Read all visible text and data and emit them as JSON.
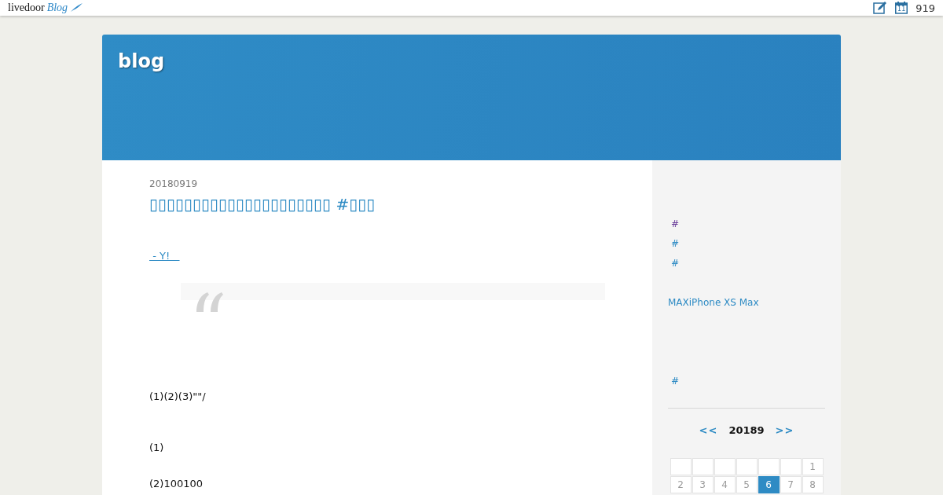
{
  "topbar": {
    "logo": {
      "brand": "livedoor",
      "product": "Blog"
    },
    "calendar_day": "11",
    "count": "919"
  },
  "header": {
    "title": "blog"
  },
  "article": {
    "date": "20180919",
    "title": "▯▯▯▯▯▯▯▯▯▯▯▯▯▯▯▯▯▯▯▯▯ #▯▯▯",
    "source_link": " - Y!   ",
    "quote": {
      "kind": "empty"
    },
    "paragraphs": [
      "(1)(2)(3)\"\"/",
      "(1)",
      "(2)100100"
    ]
  },
  "sidebar": {
    "sections": [
      {
        "links": [
          {
            "text": "#",
            "visited": true
          },
          {
            "text": "#",
            "visited": false
          },
          {
            "text": "#",
            "visited": false
          }
        ]
      },
      {
        "links": [
          {
            "text": "MAXiPhone XS Max",
            "visited": false
          }
        ]
      },
      {
        "links": [
          {
            "text": "#",
            "visited": false
          }
        ]
      }
    ],
    "calendar": {
      "prev": "<<",
      "month": "20189",
      "next": ">>",
      "weeks": [
        [
          {
            "kind": "empty"
          },
          {
            "kind": "empty"
          },
          {
            "kind": "empty"
          },
          {
            "kind": "empty"
          },
          {
            "kind": "empty"
          },
          {
            "kind": "empty"
          },
          {
            "kind": "day",
            "label": "1",
            "selected": false
          }
        ],
        [
          {
            "kind": "day",
            "label": "2",
            "selected": false
          },
          {
            "kind": "day",
            "label": "3",
            "selected": false
          },
          {
            "kind": "day",
            "label": "4",
            "selected": false
          },
          {
            "kind": "day",
            "label": "5",
            "selected": false
          },
          {
            "kind": "day",
            "label": "6",
            "selected": true
          },
          {
            "kind": "day",
            "label": "7",
            "selected": false
          },
          {
            "kind": "day",
            "label": "8",
            "selected": false
          }
        ]
      ]
    }
  }
}
